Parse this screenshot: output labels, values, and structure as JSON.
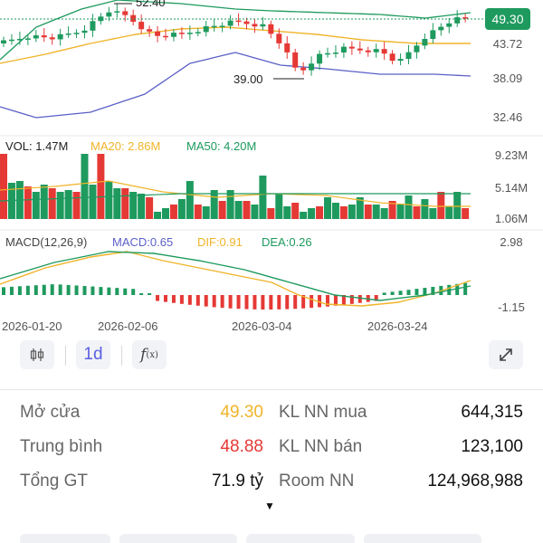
{
  "colors": {
    "up": "#1e9a5e",
    "down": "#e53935",
    "ma20": "#f0b429",
    "ma50": "#1e9a5e",
    "band": "#5b5fc7",
    "highlight": "#4ab67a"
  },
  "price_panel": {
    "current_price_badge": "49.30",
    "y_labels": [
      "43.72",
      "38.09",
      "32.46"
    ],
    "high_marker": "52.40",
    "low_marker": "39.00"
  },
  "volume_panel": {
    "vol_label": "VOL: 1.47M",
    "ma20_label": "MA20: 2.86M",
    "ma50_label": "MA50: 4.20M",
    "y_labels": [
      "9.23M",
      "5.14M",
      "1.06M"
    ]
  },
  "macd_panel": {
    "title": "MACD(12,26,9)",
    "macd_label": "MACD:0.65",
    "dif_label": "DIF:0.91",
    "dea_label": "DEA:0.26",
    "y_labels": [
      "2.98",
      "-1.15"
    ]
  },
  "x_axis_dates": [
    "2026-01-20",
    "2026-02-06",
    "2026-03-04",
    "2026-03-24"
  ],
  "toolbar": {
    "chart_type_icon": "candlestick-icon",
    "interval": "1d",
    "indicator_icon": "function-icon",
    "fullscreen_icon": "expand-icon"
  },
  "stats": {
    "open_label": "Mở cửa",
    "open_value": "49.30",
    "avg_label": "Trung bình",
    "avg_value": "48.88",
    "total_label": "Tổng GT",
    "total_value": "71.9 tỷ",
    "buy_label": "KL NN mua",
    "buy_value": "644,315",
    "sell_label": "KL NN bán",
    "sell_value": "123,100",
    "room_label": "Room NN",
    "room_value": "124,968,988",
    "expand_glyph": "▼"
  }
}
